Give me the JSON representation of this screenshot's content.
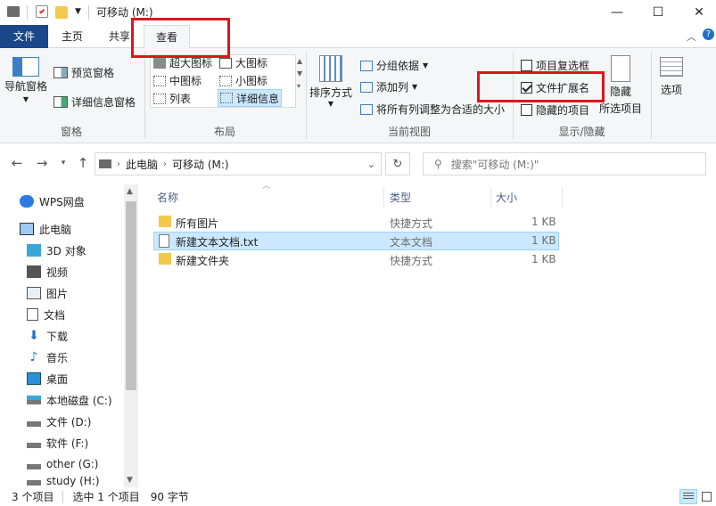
{
  "window": {
    "title": "可移动 (M:)",
    "minimize": "—",
    "maximize": "☐",
    "close": "✕"
  },
  "tabs": {
    "file": "文件",
    "home": "主页",
    "share": "共享",
    "view": "查看"
  },
  "ribbon": {
    "panes": {
      "nav_pane": "导航窗格",
      "preview_pane": "预览窗格",
      "details_pane": "详细信息窗格",
      "label": "窗格"
    },
    "layout": {
      "huge_icons": "超大图标",
      "large_icons": "大图标",
      "medium_icons": "中图标",
      "small_icons": "小图标",
      "list": "列表",
      "details": "详细信息",
      "label": "布局"
    },
    "current_view": {
      "sort_by": "排序方式",
      "group_by": "分组依据",
      "add_column": "添加列",
      "fit_columns": "将所有列调整为合适的大小",
      "label": "当前视图"
    },
    "show_hide": {
      "item_checkboxes": "项目复选框",
      "file_extensions": "文件扩展名",
      "hidden_items": "隐藏的项目",
      "hide_selected_1": "隐藏",
      "hide_selected_2": "所选项目",
      "label": "显示/隐藏",
      "item_checkboxes_checked": false,
      "file_extensions_checked": true,
      "hidden_items_checked": false
    },
    "options": "选项"
  },
  "address": {
    "path": [
      "此电脑",
      "可移动 (M:)"
    ],
    "search_placeholder": "搜索\"可移动 (M:)\""
  },
  "nav": {
    "items": [
      {
        "label": "WPS网盘",
        "icon": "cloud-icon"
      },
      {
        "label": "此电脑",
        "icon": "computer-icon"
      },
      {
        "label": "3D 对象",
        "icon": "cube-icon"
      },
      {
        "label": "视频",
        "icon": "video-icon"
      },
      {
        "label": "图片",
        "icon": "picture-icon"
      },
      {
        "label": "文档",
        "icon": "document-icon"
      },
      {
        "label": "下载",
        "icon": "download-icon"
      },
      {
        "label": "音乐",
        "icon": "music-icon"
      },
      {
        "label": "桌面",
        "icon": "desktop-icon"
      },
      {
        "label": "本地磁盘 (C:)",
        "icon": "drive-icon"
      },
      {
        "label": "文件 (D:)",
        "icon": "drive-icon"
      },
      {
        "label": "软件 (F:)",
        "icon": "drive-icon"
      },
      {
        "label": "other (G:)",
        "icon": "drive-icon"
      },
      {
        "label": "study (H:)",
        "icon": "drive-icon"
      }
    ]
  },
  "columns": {
    "name": "名称",
    "type": "类型",
    "size": "大小"
  },
  "files": [
    {
      "name": "所有图片",
      "type": "快捷方式",
      "size": "1 KB",
      "icon": "folder-shortcut-icon",
      "selected": false
    },
    {
      "name": "新建文本文档.txt",
      "type": "文本文档",
      "size": "1 KB",
      "icon": "text-file-icon",
      "selected": true
    },
    {
      "name": "新建文件夹",
      "type": "快捷方式",
      "size": "1 KB",
      "icon": "folder-shortcut-icon",
      "selected": false
    }
  ],
  "status": {
    "count": "3 个项目",
    "selection": "选中 1 个项目",
    "size": "90 字节"
  },
  "colors": {
    "file_tab": "#19478a",
    "highlight_box": "#e0141e",
    "selection": "#cce8ff",
    "ribbon_bg": "#f5f6f7"
  }
}
